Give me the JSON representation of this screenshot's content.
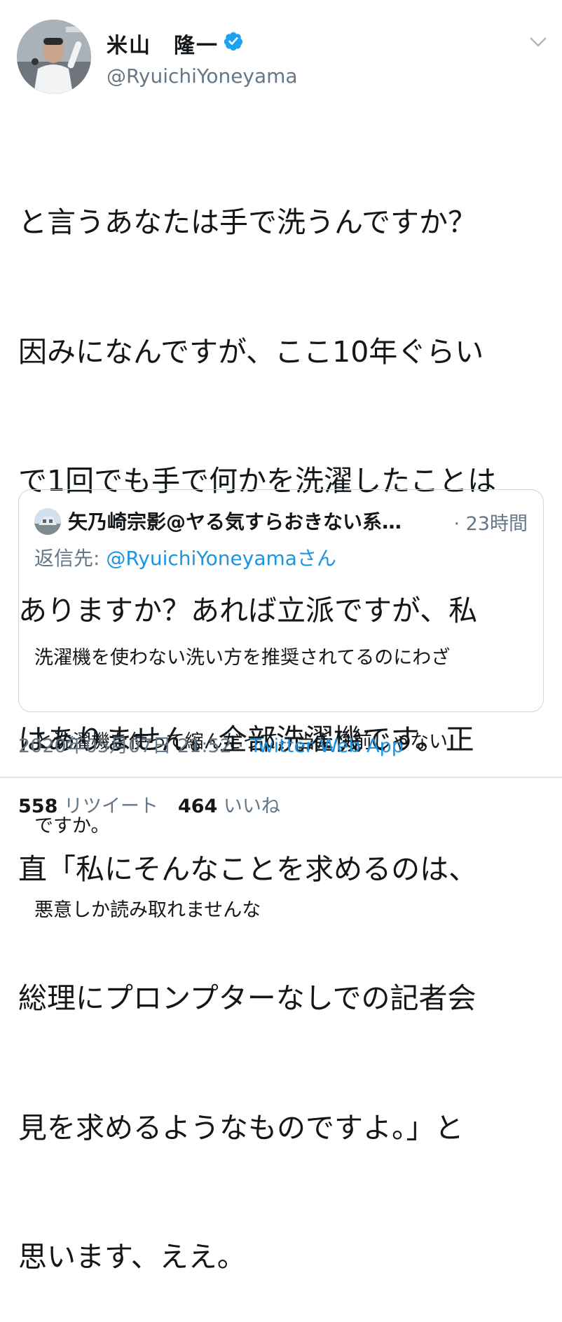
{
  "author": {
    "name": "米山　隆一",
    "handle": "@RyuichiYoneyama",
    "verified": true
  },
  "tweet": {
    "lines": [
      "と言うあなたは手で洗うんですか？",
      "因みになんですが、ここ10年ぐらい",
      "で1回でも手で何かを洗濯したことは",
      "ありますか？あれば立派ですが、私",
      "はありません。全部洗濯機です。正",
      "直「私にそんなことを求めるのは、",
      "総理にプロンプターなしでの記者会",
      "見を求めるようなものですよ。」と",
      "思います、ええ。"
    ]
  },
  "quoted_tweet": {
    "name": "矢乃崎宗影@ヤる気すらおきない系…",
    "time": "· 23時間",
    "reply_prefix": "返信先: ",
    "reply_mention": "@RyuichiYoneyamaさん",
    "lines": [
      "洗濯機を使わない洗い方を推奨されてるのにわざ",
      "と洗濯機を使って縮んだって、当たり前じゃない",
      "ですか。",
      "悪意しか読み取れませんな"
    ]
  },
  "meta": {
    "timestamp": "2020年05月07日 21:52",
    "separator": " · ",
    "source": "Twitter Web App"
  },
  "stats": {
    "retweets_count": "558",
    "retweets_label": " リツイート",
    "likes_count": "464",
    "likes_label": " いいね"
  },
  "icons": {
    "verified": "verified-badge-icon",
    "caret": "chevron-down-icon"
  },
  "colors": {
    "text": "#14171a",
    "secondary": "#657786",
    "link": "#1b95e0",
    "verified": "#1da1f2",
    "border": "#ccd6dd"
  }
}
